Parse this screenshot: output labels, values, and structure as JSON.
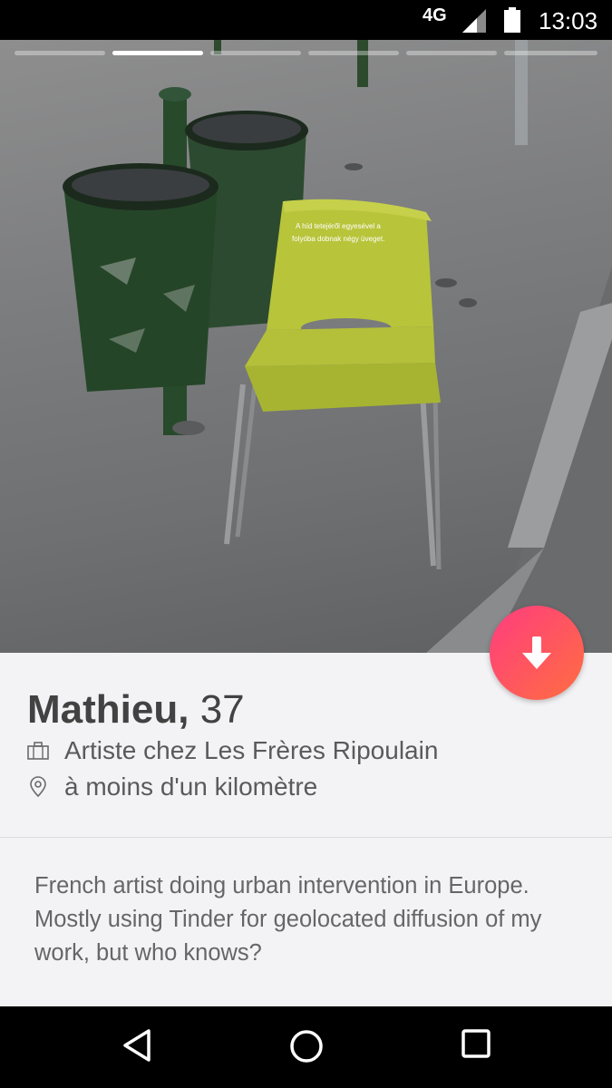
{
  "status_bar": {
    "network": "4G",
    "time": "13:03",
    "signal_icon": "signal-icon",
    "battery_icon": "battery-icon"
  },
  "photo": {
    "indicator_count": 6,
    "active_index": 1,
    "chair_text_line1": "A híd tetejéről egyesével a",
    "chair_text_line2": "folyóba dobnak négy üveget."
  },
  "profile": {
    "name": "Mathieu,",
    "age": "37",
    "job": "Artiste chez Les Frères Ripoulain",
    "job_icon": "briefcase-icon",
    "distance": "à moins d'un kilomètre",
    "distance_icon": "location-pin-icon",
    "bio": "French artist doing urban intervention in Europe. Mostly using Tinder for geolocated diffusion of my work, but who knows?"
  },
  "actions": {
    "expand_icon": "arrow-down-icon",
    "accent_gradient": [
      "#ff3d7f",
      "#ff6e40"
    ]
  },
  "nav": {
    "back_icon": "back-triangle-icon",
    "home_icon": "home-circle-icon",
    "recents_icon": "recents-square-icon"
  }
}
